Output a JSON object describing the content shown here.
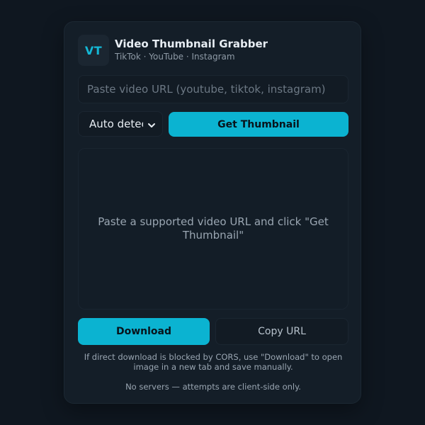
{
  "header": {
    "logo_text": "VT",
    "title": "Video Thumbnail Grabber",
    "subtitle": "TikTok · YouTube · Instagram"
  },
  "input": {
    "placeholder": "Paste video URL (youtube, tiktok, instagram)",
    "value": ""
  },
  "platform_select": {
    "selected": "Auto detect",
    "icon": "chevron-down-icon"
  },
  "actions": {
    "get_thumbnail": "Get Thumbnail",
    "download": "Download",
    "copy_url": "Copy URL"
  },
  "preview": {
    "message": "Paste a supported video URL and click \"Get Thumbnail\""
  },
  "notes": {
    "cors": "If direct download is blocked by CORS, use \"Download\" to open image in a new tab and save manually.",
    "footer": "No servers — attempts are client-side only."
  },
  "colors": {
    "background": "#0f1720",
    "card": "#141e28",
    "accent": "#0bb3d1",
    "text": "#e7edf3",
    "muted": "#9aa6b2"
  }
}
